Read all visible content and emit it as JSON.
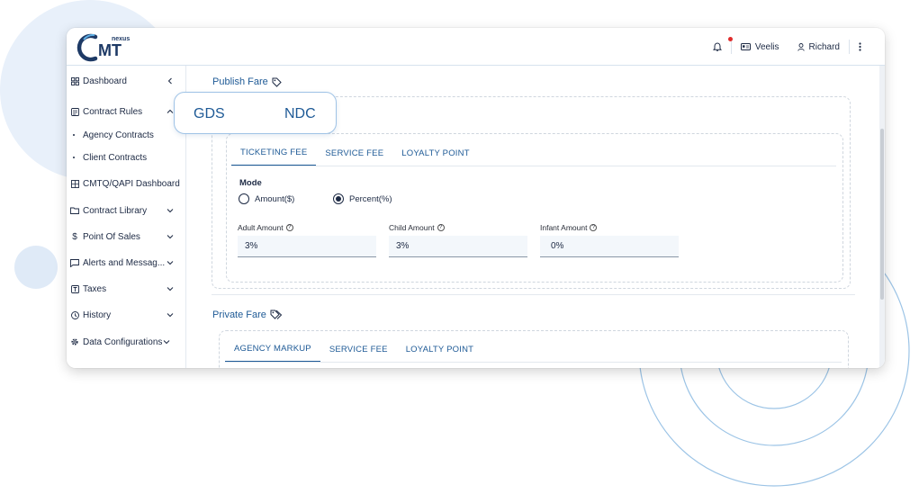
{
  "app": {
    "logo_small": "nexus",
    "logo_big": "CMT"
  },
  "topbar": {
    "bell_icon": "bell-icon",
    "company": "Veelis",
    "user": "Richard"
  },
  "sidebar": {
    "items": [
      {
        "label": "Dashboard",
        "icon": "dashboard-icon",
        "chevron": "chevron-left"
      },
      {
        "label": "Contract Rules",
        "icon": "document-icon",
        "chevron": "chevron-up"
      },
      {
        "label": "CMTQ/QAPI Dashboard",
        "icon": "grid-icon",
        "chevron": ""
      },
      {
        "label": "Contract Library",
        "icon": "folder-icon",
        "chevron": "chevron-down"
      },
      {
        "label": "Point Of Sales",
        "icon": "dollar-icon",
        "chevron": "chevron-down"
      },
      {
        "label": "Alerts and Messag...",
        "icon": "message-icon",
        "chevron": "chevron-down"
      },
      {
        "label": "Taxes",
        "icon": "tax-icon",
        "chevron": "chevron-down"
      },
      {
        "label": "History",
        "icon": "clock-icon",
        "chevron": "chevron-down"
      },
      {
        "label": "Data Configurations",
        "icon": "gear-icon",
        "chevron": "chevron-down"
      }
    ],
    "subitems": [
      {
        "label": "Agency Contracts"
      },
      {
        "label": "Client Contracts"
      }
    ]
  },
  "pill": {
    "left": "GDS",
    "right": "NDC"
  },
  "publish_fare": {
    "title": "Publish Fare",
    "tabs": [
      "TICKETING FEE",
      "SERVICE FEE",
      "LOYALTY POINT"
    ],
    "mode_label": "Mode",
    "mode_options": [
      {
        "label": "Amount($)",
        "selected": false
      },
      {
        "label": "Percent(%)",
        "selected": true
      }
    ],
    "fields": [
      {
        "label": "Adult Amount",
        "value": "3%"
      },
      {
        "label": "Child Amount",
        "value": "3%"
      },
      {
        "label": "Infant Amount",
        "value": "0%"
      }
    ]
  },
  "private_fare": {
    "title": "Private Fare",
    "tabs": [
      "AGENCY MARKUP",
      "SERVICE FEE",
      "LOYALTY POINT"
    ]
  },
  "colors": {
    "accent": "#1e5a96",
    "text": "#1d2a44",
    "notification": "#e02b2b"
  }
}
